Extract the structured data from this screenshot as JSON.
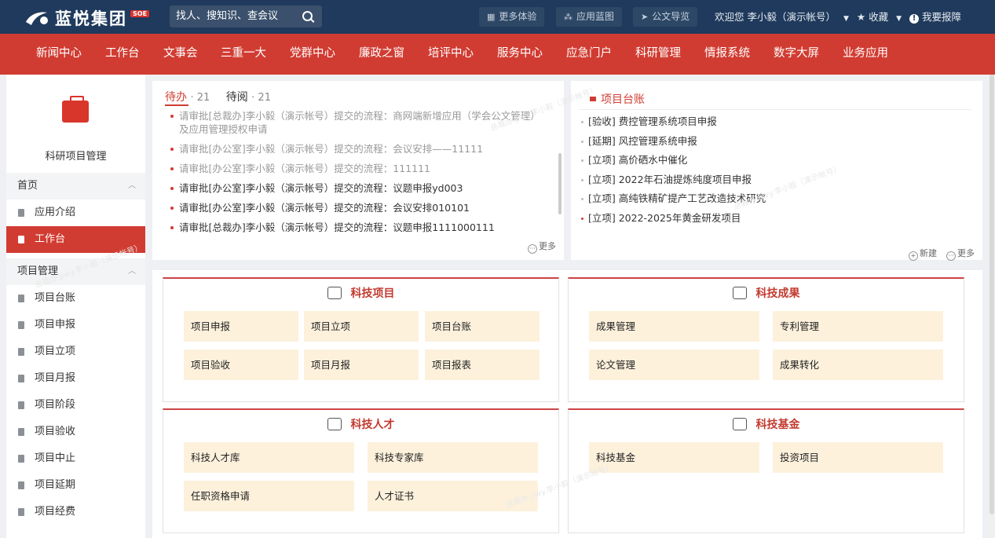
{
  "brand": {
    "name": "蓝悦集团",
    "badge": "SOE"
  },
  "search": {
    "placeholder": "找人、搜知识、查会议"
  },
  "toolbar": {
    "more_exp": "更多体验",
    "app_blue": "应用蓝图",
    "doc_nav": "公文导览"
  },
  "user": {
    "welcome": "欢迎您  李小毅（演示帐号）",
    "favorites": "收藏",
    "report": "我要报障"
  },
  "nav": [
    "新闻中心",
    "工作台",
    "文事会",
    "三重一大",
    "党群中心",
    "廉政之窗",
    "培评中心",
    "服务中心",
    "应急门户",
    "科研管理",
    "情报系统",
    "数字大屏",
    "业务应用"
  ],
  "sidebar": {
    "title": "科研项目管理",
    "groups": [
      {
        "label": "首页",
        "items": [
          "应用介绍",
          "工作台"
        ]
      },
      {
        "label": "项目管理",
        "items": [
          "项目台账",
          "项目申报",
          "项目立项",
          "项目月报",
          "项目阶段",
          "项目验收",
          "项目中止",
          "项目延期",
          "项目经费"
        ]
      }
    ]
  },
  "todo": {
    "tab_pending": "待办",
    "pending_count": "· 21",
    "tab_read": "待阅",
    "read_count": "· 21",
    "more": "更多",
    "items": [
      {
        "text": "请审批[总裁办]李小毅（演示帐号）提交的流程：商网端新增应用（学会公文管理）及应用管理授权申请",
        "read": true
      },
      {
        "text": "请审批[办公室]李小毅（演示帐号）提交的流程：会议安排——11111",
        "read": true
      },
      {
        "text": "请审批[办公室]李小毅（演示帐号）提交的流程：111111",
        "read": true
      },
      {
        "text": "请审批[办公室]李小毅（演示帐号）提交的流程：议题申报yd003",
        "read": false
      },
      {
        "text": "请审批[办公室]李小毅（演示帐号）提交的流程：会议安排010101",
        "read": false
      },
      {
        "text": "请审批[总裁办]李小毅（演示帐号）提交的流程：议题申报1111000111",
        "read": false
      }
    ]
  },
  "ledger": {
    "title": "项目台账",
    "new": "新建",
    "more": "更多",
    "items": [
      {
        "text": "[验收] 费控管理系统项目申报",
        "hot": false
      },
      {
        "text": "[延期] 风控管理系统申报",
        "hot": false
      },
      {
        "text": "[立项] 高价硒水中催化",
        "hot": false
      },
      {
        "text": "[立项] 2022年石油提炼纯度项目申报",
        "hot": false
      },
      {
        "text": "[立项] 高纯铁精矿提产工艺改造技术研究",
        "hot": false
      },
      {
        "text": "[立项] 2022-2025年黄金研发项目",
        "hot": true
      }
    ]
  },
  "cards": {
    "tech_project": {
      "title": "科技项目",
      "tiles": [
        "项目申报",
        "项目立项",
        "项目台账",
        "项目验收",
        "项目月报",
        "项目报表"
      ]
    },
    "tech_result": {
      "title": "科技成果",
      "tiles": [
        "成果管理",
        "专利管理",
        "论文管理",
        "成果转化"
      ]
    },
    "tech_talent": {
      "title": "科技人才",
      "tiles": [
        "科技人才库",
        "科技专家库",
        "任职资格申请",
        "人才证书"
      ]
    },
    "tech_fund": {
      "title": "科技基金",
      "tiles": [
        "科技基金",
        "投资项目"
      ]
    }
  },
  "watermark": "总裁办.jiwy.李小毅（演示帐号）"
}
